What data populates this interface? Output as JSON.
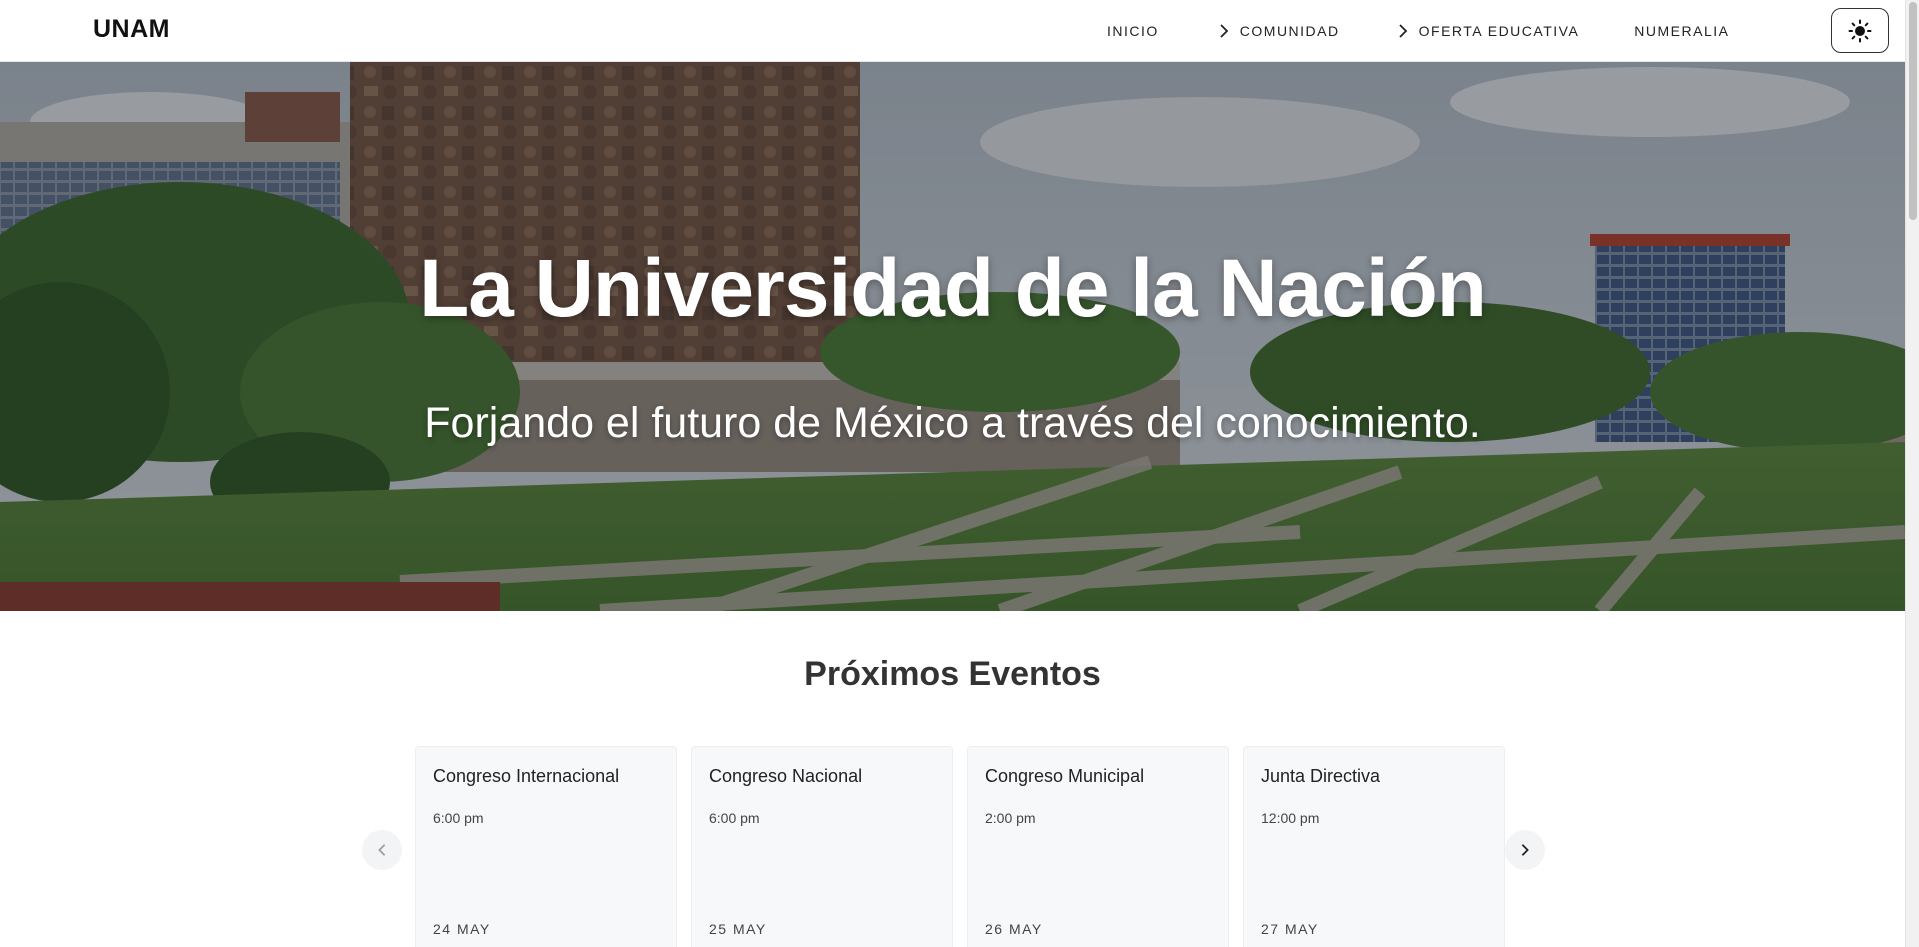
{
  "header": {
    "logo": "UNAM",
    "nav": [
      {
        "label": "INICIO",
        "has_chevron": false
      },
      {
        "label": "COMUNIDAD",
        "has_chevron": true
      },
      {
        "label": "OFERTA EDUCATIVA",
        "has_chevron": true
      },
      {
        "label": "NUMERALIA",
        "has_chevron": false
      }
    ],
    "theme_icon": "sun-icon"
  },
  "hero": {
    "title": "La Universidad de la Nación",
    "subtitle": "Forjando el futuro de México a través del conocimiento."
  },
  "events": {
    "title": "Próximos Eventos",
    "items": [
      {
        "title": "Congreso Internacional",
        "time": "6:00 pm",
        "date": "24 MAY"
      },
      {
        "title": "Congreso Nacional",
        "time": "6:00 pm",
        "date": "25 MAY"
      },
      {
        "title": "Congreso Municipal",
        "time": "2:00 pm",
        "date": "26 MAY"
      },
      {
        "title": "Junta Directiva",
        "time": "12:00 pm",
        "date": "27 MAY"
      }
    ],
    "prev_icon": "chevron-left-icon",
    "next_icon": "chevron-right-icon"
  },
  "colors": {
    "header_bg": "#ffffff",
    "hero_overlay": "#14181e",
    "card_bg": "#f7f8fa",
    "sky": "#c9d2dc",
    "grass": "#5f8f3e"
  }
}
